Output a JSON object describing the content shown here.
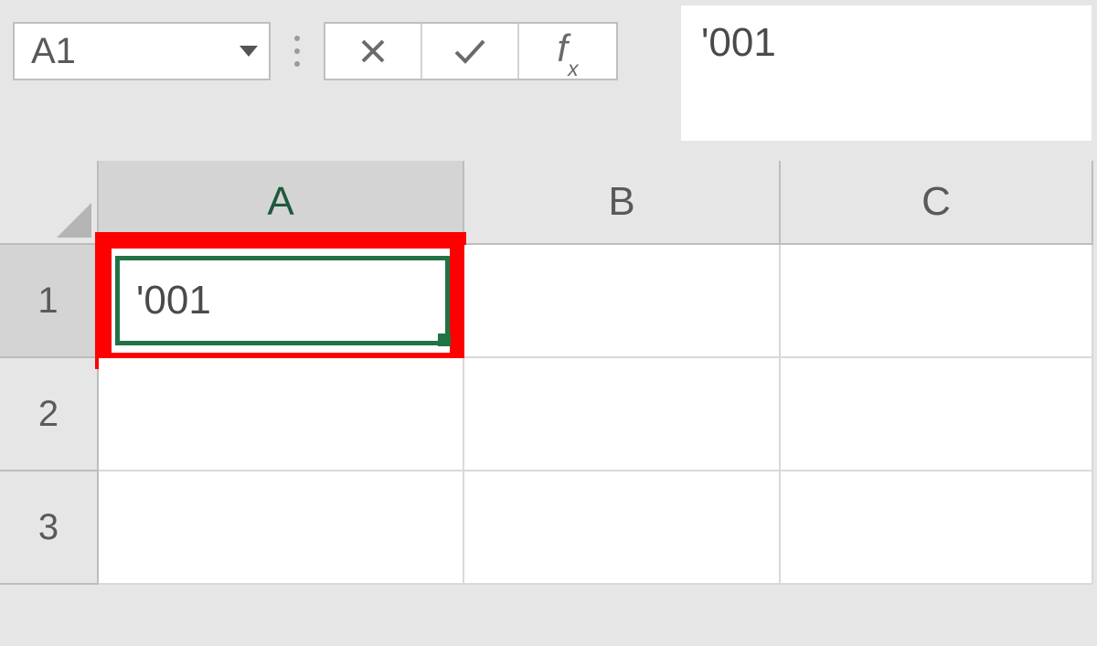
{
  "name_box": {
    "value": "A1"
  },
  "formula_bar": {
    "value": "'001"
  },
  "columns": [
    "A",
    "B",
    "C"
  ],
  "rows": [
    "1",
    "2",
    "3"
  ],
  "active_cell": {
    "ref": "A1",
    "display": "'001"
  },
  "colors": {
    "excel_green": "#217346",
    "annotation_red": "#ff0000",
    "header_bg": "#e6e6e6"
  }
}
